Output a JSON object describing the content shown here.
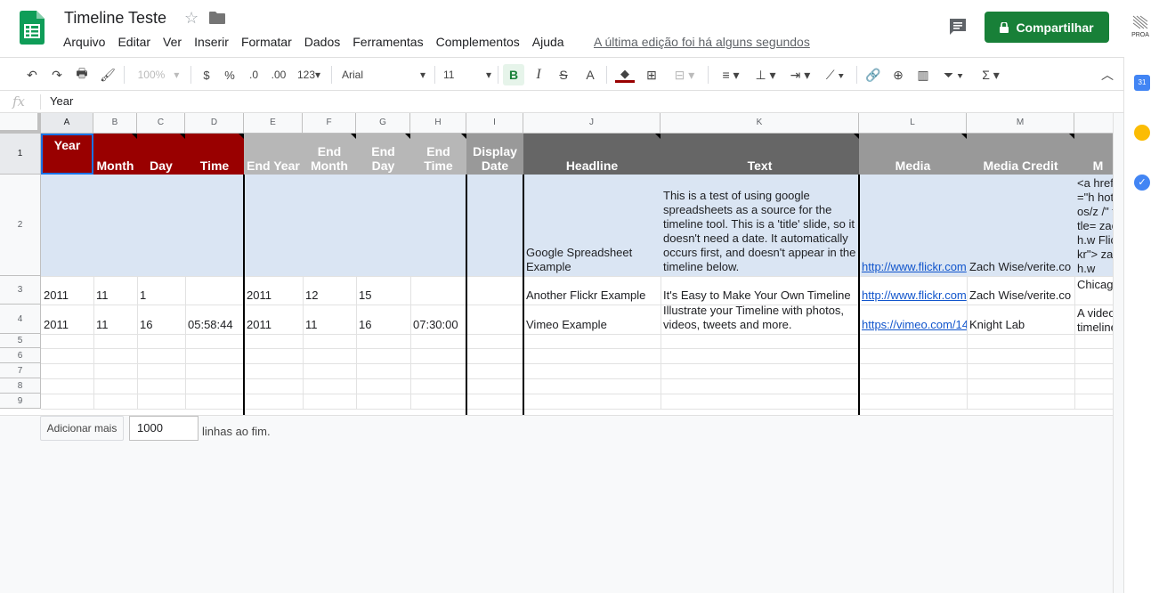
{
  "app": {
    "doc_title": "Timeline Teste",
    "menu": [
      "Arquivo",
      "Editar",
      "Ver",
      "Inserir",
      "Formatar",
      "Dados",
      "Ferramentas",
      "Complementos",
      "Ajuda"
    ],
    "last_edit": "A última edição foi há alguns segundos",
    "share_label": "Compartilhar",
    "account_label": "PROA"
  },
  "toolbar": {
    "zoom": "100%",
    "currency": "$",
    "percent": "%",
    "dec_less": ".0",
    "dec_more": ".00",
    "number_format": "123",
    "font": "Arial",
    "font_size": "11",
    "bold": "B",
    "italic": "I",
    "strike": "S",
    "text_color": "A",
    "sigma": "Σ"
  },
  "formula_bar": {
    "fx": "fx",
    "value": "Year"
  },
  "colors": {
    "dark_red": "#990000",
    "light_gray": "#b7b7b7",
    "dark_gray": "#666666",
    "mid_gray": "#999999",
    "selection": "#dae5f3",
    "share_green": "#188038"
  },
  "grid": {
    "columns": [
      "A",
      "B",
      "C",
      "D",
      "E",
      "F",
      "G",
      "H",
      "I",
      "J",
      "K",
      "L",
      "M",
      ""
    ],
    "rows": [
      "1",
      "2",
      "3",
      "4",
      "5",
      "6",
      "7",
      "8",
      "9"
    ],
    "header_row": [
      "Year",
      "Month",
      "Day",
      "Time",
      "End Year",
      "End Month",
      "End Day",
      "End Time",
      "Display Date",
      "Headline",
      "Text",
      "Media",
      "Media Credit",
      "M"
    ],
    "row2": {
      "J": "Google Spreadsheet Example",
      "K": "This is a test of using google spreadsheets as a source for the timeline tool. This is a 'title' slide, so it doesn't need a date. It automatically occurs first, and doesn't appear in the timeline below.",
      "L": "http://www.flickr.com",
      "M": "Zach Wise/verite.co",
      "N": "<a href=\"h hotos/z /\" title= zach.w Flickr\"> zach.w"
    },
    "row3": {
      "A": "2011",
      "B": "11",
      "C": "1",
      "E": "2011",
      "F": "12",
      "G": "15",
      "J": "Another Flickr Example",
      "K": "It's Easy to Make Your Own Timeline",
      "L": "http://www.flickr.com",
      "M": "Zach Wise/verite.co",
      "N": "Chicag"
    },
    "row4": {
      "A": "2011",
      "B": "11",
      "C": "16",
      "D": "05:58:44",
      "E": "2011",
      "F": "11",
      "G": "16",
      "H": "07:30:00",
      "J": "Vimeo Example",
      "K": "Illustrate your Timeline with photos, videos, tweets and more.",
      "L": "https://vimeo.com/14",
      "M": "Knight Lab",
      "N": "A video timeline"
    }
  },
  "footer": {
    "add_more_label": "Adicionar mais",
    "rows_value": "1000",
    "rows_suffix": "linhas ao fim."
  }
}
